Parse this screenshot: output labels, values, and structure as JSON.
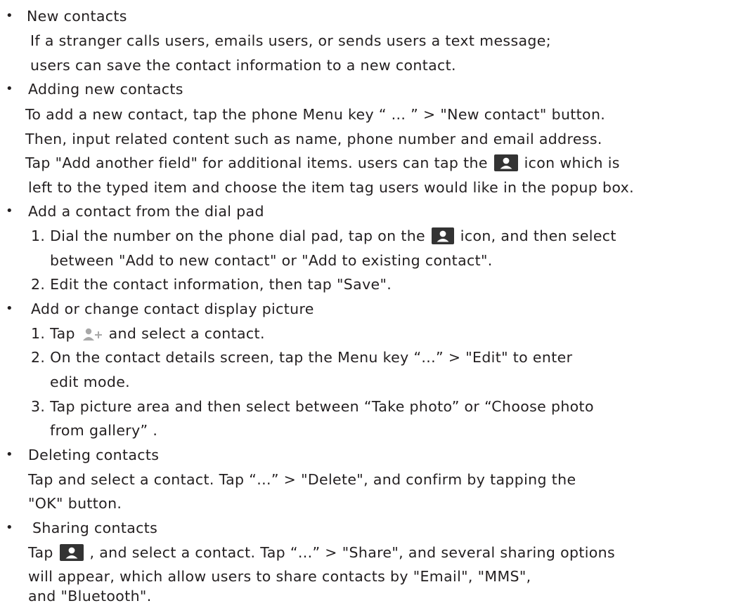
{
  "sections": [
    {
      "heading": "New contacts",
      "lines": [
        "If a stranger calls users, emails users, or sends users a text message;",
        "users can save the contact information to a new contact."
      ]
    },
    {
      "heading": "Adding new contacts",
      "lines": [
        "To add a new contact, tap the phone Menu key “ ... ” > \"New contact\" button.",
        "Then, input related content such as name, phone number and email address.",
        "Tap \"Add another field\" for additional items. users can tap the",
        "icon which is",
        "left to the typed item and choose the item tag users would like in the popup box."
      ]
    },
    {
      "heading": "Add a contact from the dial pad",
      "lines": [
        "1. Dial the number on the phone dial pad, tap on the",
        "icon, and then select",
        "between \"Add to new contact\" or \"Add to existing contact\".",
        "2. Edit the contact information, then tap \"Save\"."
      ]
    },
    {
      "heading": "Add or change contact display picture",
      "lines": [
        "1. Tap",
        "and select a contact.",
        "2. On the contact details screen, tap the Menu key “...” > \"Edit\" to enter",
        "edit mode.",
        "3. Tap picture area and then select between “Take photo” or “Choose photo",
        "from gallery” ."
      ]
    },
    {
      "heading": "Deleting contacts",
      "lines": [
        "Tap and select a contact. Tap “...” > \"Delete\", and confirm by tapping the",
        "\"OK\" button."
      ]
    },
    {
      "heading": "Sharing contacts",
      "lines": [
        "Tap",
        ", and select a contact. Tap “...” > \"Share\", and several sharing options",
        "will appear, which allow users to share contacts by \"Email\", \"MMS\",",
        "and \"Bluetooth\"."
      ]
    }
  ],
  "bullet_char": "•",
  "colors": {
    "text": "#231f20",
    "icon_dark": "#333333",
    "icon_light": "#a8a8a8"
  },
  "icons": [
    "contact-icon",
    "add-contact-icon"
  ]
}
